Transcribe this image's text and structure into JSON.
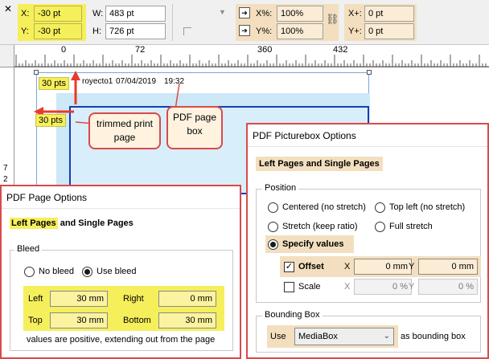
{
  "toolbar": {
    "x_label": "X:",
    "x_value": "-30 pt",
    "y_label": "Y:",
    "y_value": "-30 pt",
    "w_label": "W:",
    "w_value": "483 pt",
    "h_label": "H:",
    "h_value": "726 pt",
    "xscale_label": "X%:",
    "xscale_value": "100%",
    "yscale_label": "Y%:",
    "yscale_value": "100%",
    "xoffset_label": "X+:",
    "xoffset_value": "0 pt",
    "yoffset_label": "Y+:",
    "yoffset_value": "0 pt"
  },
  "ruler": {
    "ticks": [
      "0",
      "72",
      "360",
      "432"
    ]
  },
  "canvas": {
    "top_label": "30 pts",
    "left_label": "30 pts",
    "header_text": "royecto1",
    "header_date": "07/04/2019",
    "header_time": "19:32",
    "vruler_nums": [
      "7",
      "2"
    ]
  },
  "callouts": {
    "trimmed": "trimmed print page",
    "pdfbox": "PDF page box"
  },
  "page_options": {
    "title": "PDF Page Options",
    "heading_hl": "Left Pages",
    "heading_rest": " and Single Pages",
    "bleed_group": "Bleed",
    "no_bleed": "No bleed",
    "use_bleed": "Use bleed",
    "left_label": "Left",
    "left_value": "30 mm",
    "right_label": "Right",
    "right_value": "0 mm",
    "top_label": "Top",
    "top_value": "30 mm",
    "bottom_label": "Bottom",
    "bottom_value": "30 mm",
    "note": "values are positive, extending out from the page"
  },
  "picturebox": {
    "title": "PDF Picturebox Options",
    "heading": "Left Pages and Single Pages",
    "position_group": "Position",
    "centered": "Centered (no stretch)",
    "top_left": "Top left (no stretch)",
    "stretch_keep": "Stretch (keep ratio)",
    "full_stretch": "Full stretch",
    "specify": "Specify values",
    "offset_label": "Offset",
    "x_label": "X",
    "offset_x": "0 mm",
    "y_label": "Y",
    "offset_y": "0 mm",
    "scale_label": "Scale",
    "scale_x": "0 %",
    "scale_y": "0 %",
    "bbox_group": "Bounding Box",
    "use_label": "Use",
    "bbox_value": "MediaBox",
    "bbox_suffix": "as bounding box"
  }
}
